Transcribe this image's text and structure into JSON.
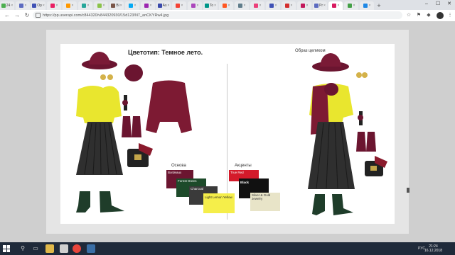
{
  "tabs": [
    {
      "label": "24",
      "color": "#4caf50"
    },
    {
      "label": "",
      "color": "#5c6bc0"
    },
    {
      "label": "Op",
      "color": "#3f51b5"
    },
    {
      "label": "",
      "color": "#e91e63"
    },
    {
      "label": "",
      "color": "#ff9800"
    },
    {
      "label": "",
      "color": "#26a69a"
    },
    {
      "label": "",
      "color": "#8bc34a"
    },
    {
      "label": "Bi",
      "color": "#795548"
    },
    {
      "label": "",
      "color": "#03a9f4"
    },
    {
      "label": "",
      "color": "#9c27b0"
    },
    {
      "label": "As",
      "color": "#3949ab"
    },
    {
      "label": "",
      "color": "#f44336"
    },
    {
      "label": "",
      "color": "#ab47bc"
    },
    {
      "label": "To",
      "color": "#009688"
    },
    {
      "label": "",
      "color": "#ff5722"
    },
    {
      "label": "",
      "color": "#607d8b"
    },
    {
      "label": "",
      "color": "#ec407a"
    },
    {
      "label": "",
      "color": "#3f51b5"
    },
    {
      "label": "",
      "color": "#d32f2f"
    },
    {
      "label": "",
      "color": "#c2185b"
    },
    {
      "label": "Pr",
      "color": "#5c6bc0"
    },
    {
      "label": "",
      "color": "#d81b60"
    },
    {
      "label": "",
      "color": "#43a047"
    },
    {
      "label": "",
      "color": "#1e88e5"
    }
  ],
  "url": "https://pp.userapi.com/c844320/v844320930/15d123/N7_anCKYRw4.jpg",
  "image": {
    "title": "Цветотип: Темное лето.",
    "subtitle": "Образ целиком",
    "base_label": "Основа",
    "accent_label": "Акценты",
    "base_swatches": [
      {
        "text": "Bordeaux",
        "bg": "#6b1530",
        "fg": "#ffffff"
      },
      {
        "text": "Forest Green",
        "bg": "#1d4a2a",
        "fg": "#ffffff"
      },
      {
        "text": "Charcoal",
        "bg": "#3a3a3a",
        "fg": "#ffffff"
      },
      {
        "text": "Light Lemon Yellow",
        "bg": "#f5ee4a",
        "fg": "#222222"
      }
    ],
    "accent_swatches": [
      {
        "text": "True Red",
        "bg": "#d41a2a",
        "fg": "#ffffff"
      },
      {
        "text": "Black",
        "bg": "#111111",
        "fg": "#ffffff"
      },
      {
        "text": "Silver & Gold Jewelry",
        "bg": "#e8e4c8",
        "fg": "#333333"
      }
    ]
  },
  "taskbar": {
    "time": "21:24",
    "date": "16.12.2018",
    "lang": "РУС"
  }
}
